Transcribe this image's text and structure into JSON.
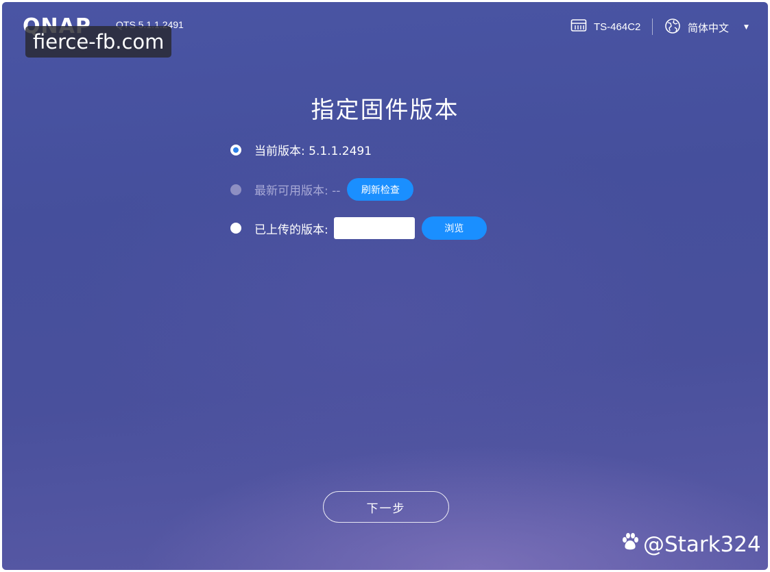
{
  "header": {
    "logo_text": "QNAP",
    "os_version": "QTS 5.1.1.2491",
    "model": "TS-464C2",
    "language": "简体中文",
    "watermark": "fierce-fb.com"
  },
  "page": {
    "title": "指定固件版本"
  },
  "options": {
    "current": {
      "label": "当前版本: 5.1.1.2491",
      "selected": true
    },
    "latest": {
      "label": "最新可用版本: --",
      "button": "刷新检查",
      "enabled": false
    },
    "uploaded": {
      "label": "已上传的版本:",
      "value": "",
      "button": "浏览"
    }
  },
  "footer": {
    "next_button": "下一步",
    "watermark": "@Stark324"
  },
  "colors": {
    "accent": "#1a8fff",
    "background": "#4a55a4"
  },
  "icons": {
    "model": "nas-device-icon",
    "language": "globe-icon",
    "dropdown": "caret-down-icon",
    "watermark": "baidu-paw-icon"
  }
}
